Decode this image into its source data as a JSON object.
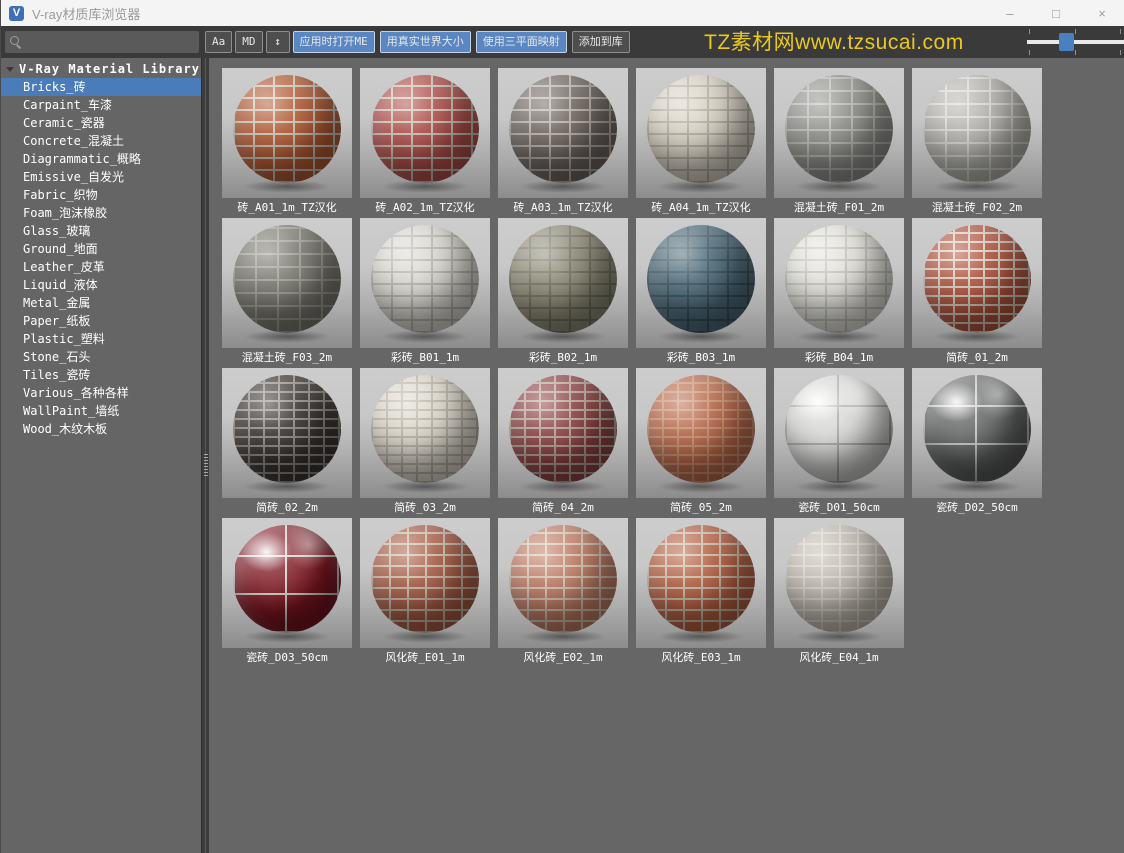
{
  "window": {
    "title": "V-ray材质库浏览器",
    "logo_letter": "V",
    "minimize": "–",
    "maximize": "□",
    "close": "×"
  },
  "toolbar": {
    "search": {
      "value": "",
      "placeholder": ""
    },
    "buttons": [
      {
        "id": "aa",
        "label": "Aa",
        "active": false
      },
      {
        "id": "md",
        "label": "MD",
        "active": false
      },
      {
        "id": "updown",
        "label": "↕",
        "active": false
      },
      {
        "id": "open-me-on-apply",
        "label": "应用时打开ME",
        "active": true
      },
      {
        "id": "real-world-size",
        "label": "用真实世界大小",
        "active": true
      },
      {
        "id": "triplanar-mapping",
        "label": "使用三平面映射",
        "active": true
      },
      {
        "id": "add-to-library",
        "label": "添加到库",
        "active": false
      }
    ],
    "watermark": {
      "text": "TZ素材网www.tzsucai.com",
      "color": "#e9c81f"
    },
    "slider": {
      "percent": 38,
      "ticks": 3
    }
  },
  "colors": {
    "selection_blue": "#4a7cba",
    "button_blue": "#5a86c2",
    "toolbar_bg": "#3a3a3a",
    "panel_bg": "#656565"
  },
  "sidebar": {
    "root_label": "V-Ray Material Library",
    "items": [
      {
        "label": "Bricks_砖",
        "selected": true
      },
      {
        "label": "Carpaint_车漆",
        "selected": false
      },
      {
        "label": "Ceramic_瓷器",
        "selected": false
      },
      {
        "label": "Concrete_混凝土",
        "selected": false
      },
      {
        "label": "Diagrammatic_概略",
        "selected": false
      },
      {
        "label": "Emissive_自发光",
        "selected": false
      },
      {
        "label": "Fabric_织物",
        "selected": false
      },
      {
        "label": "Foam_泡沫橡胶",
        "selected": false
      },
      {
        "label": "Glass_玻璃",
        "selected": false
      },
      {
        "label": "Ground_地面",
        "selected": false
      },
      {
        "label": "Leather_皮革",
        "selected": false
      },
      {
        "label": "Liquid_液体",
        "selected": false
      },
      {
        "label": "Metal_金属",
        "selected": false
      },
      {
        "label": "Paper_纸板",
        "selected": false
      },
      {
        "label": "Plastic_塑料",
        "selected": false
      },
      {
        "label": "Stone_石头",
        "selected": false
      },
      {
        "label": "Tiles_瓷砖",
        "selected": false
      },
      {
        "label": "Various_各种各样",
        "selected": false
      },
      {
        "label": "WallPaint_墙纸",
        "selected": false
      },
      {
        "label": "Wood_木纹木板",
        "selected": false
      }
    ]
  },
  "materials": [
    {
      "label": "砖_A01_1m_TZ汉化",
      "brick": "#b35a33",
      "mortar": "#cdc5b8",
      "brick_w": 20,
      "brick_h": 12,
      "finish": "matte"
    },
    {
      "label": "砖_A02_1m_TZ汉化",
      "brick": "#b04f4a",
      "mortar": "#cbc2b4",
      "brick_w": 20,
      "brick_h": 12,
      "finish": "matte"
    },
    {
      "label": "砖_A03_1m_TZ汉化",
      "brick": "#6e6662",
      "mortar": "#b6afa4",
      "brick_w": 20,
      "brick_h": 12,
      "finish": "matte"
    },
    {
      "label": "砖_A04_1m_TZ汉化",
      "brick": "#d9d3c5",
      "mortar": "#b3ac9d",
      "brick_w": 20,
      "brick_h": 12,
      "finish": "matte"
    },
    {
      "label": "混凝土砖_F01_2m",
      "brick": "#90908c",
      "mortar": "#b9b9b4",
      "brick_w": 22,
      "brick_h": 13,
      "finish": "matte"
    },
    {
      "label": "混凝土砖_F02_2m",
      "brick": "#b4b3ae",
      "mortar": "#d8d7d2",
      "brick_w": 22,
      "brick_h": 13,
      "finish": "matte"
    },
    {
      "label": "混凝土砖_F03_2m",
      "brick": "#7a7971",
      "mortar": "#a09f97",
      "brick_w": 22,
      "brick_h": 13,
      "finish": "matte"
    },
    {
      "label": "彩砖_B01_1m",
      "brick": "#dbd9d2",
      "mortar": "#b5b3ac",
      "brick_w": 20,
      "brick_h": 12,
      "finish": "matte"
    },
    {
      "label": "彩砖_B02_1m",
      "brick": "#8e8c77",
      "mortar": "#716f5e",
      "brick_w": 20,
      "brick_h": 12,
      "finish": "matte"
    },
    {
      "label": "彩砖_B03_1m",
      "brick": "#4d6a79",
      "mortar": "#37505c",
      "brick_w": 20,
      "brick_h": 12,
      "finish": "matte"
    },
    {
      "label": "彩砖_B04_1m",
      "brick": "#e4e3dd",
      "mortar": "#c4c3bb",
      "brick_w": 20,
      "brick_h": 12,
      "finish": "matte"
    },
    {
      "label": "简砖_01_2m",
      "brick": "#b2533c",
      "mortar": "#d7cdc1",
      "brick_w": 15,
      "brick_h": 9,
      "finish": "matte"
    },
    {
      "label": "简砖_02_2m",
      "brick": "#3a3431",
      "mortar": "#8f8c87",
      "brick_w": 15,
      "brick_h": 9,
      "finish": "matte"
    },
    {
      "label": "简砖_03_2m",
      "brick": "#ded9cd",
      "mortar": "#b8b3a5",
      "brick_w": 15,
      "brick_h": 9,
      "finish": "matte"
    },
    {
      "label": "简砖_04_2m",
      "brick": "#8e4244",
      "mortar": "#b7a598",
      "brick_w": 15,
      "brick_h": 9,
      "finish": "matte"
    },
    {
      "label": "简砖_05_2m",
      "brick": "#b96849",
      "mortar": "#ca9170",
      "brick_w": 15,
      "brick_h": 9,
      "finish": "matte"
    },
    {
      "label": "瓷砖_D01_50cm",
      "brick": "#d9d9d7",
      "mortar": "#a8a8a6",
      "brick_w": 52,
      "brick_h": 38,
      "finish": "glossy"
    },
    {
      "label": "瓷砖_D02_50cm",
      "brick": "#5e615f",
      "mortar": "#c5c7c6",
      "brick_w": 52,
      "brick_h": 38,
      "finish": "glossy"
    },
    {
      "label": "瓷砖_D03_50cm",
      "brick": "#7d1520",
      "mortar": "#d6d1cb",
      "brick_w": 52,
      "brick_h": 38,
      "finish": "glossy"
    },
    {
      "label": "风化砖_E01_1m",
      "brick": "#a85b44",
      "mortar": "#c9b9a6",
      "brick_w": 18,
      "brick_h": 11,
      "finish": "matte"
    },
    {
      "label": "风化砖_E02_1m",
      "brick": "#c07c64",
      "mortar": "#d5c5b3",
      "brick_w": 18,
      "brick_h": 11,
      "finish": "matte"
    },
    {
      "label": "风化砖_E03_1m",
      "brick": "#b55f41",
      "mortar": "#c9baa6",
      "brick_w": 18,
      "brick_h": 11,
      "finish": "matte"
    },
    {
      "label": "风化砖_E04_1m",
      "brick": "#c1bbb1",
      "mortar": "#d9d3c9",
      "brick_w": 18,
      "brick_h": 11,
      "finish": "matte"
    }
  ]
}
